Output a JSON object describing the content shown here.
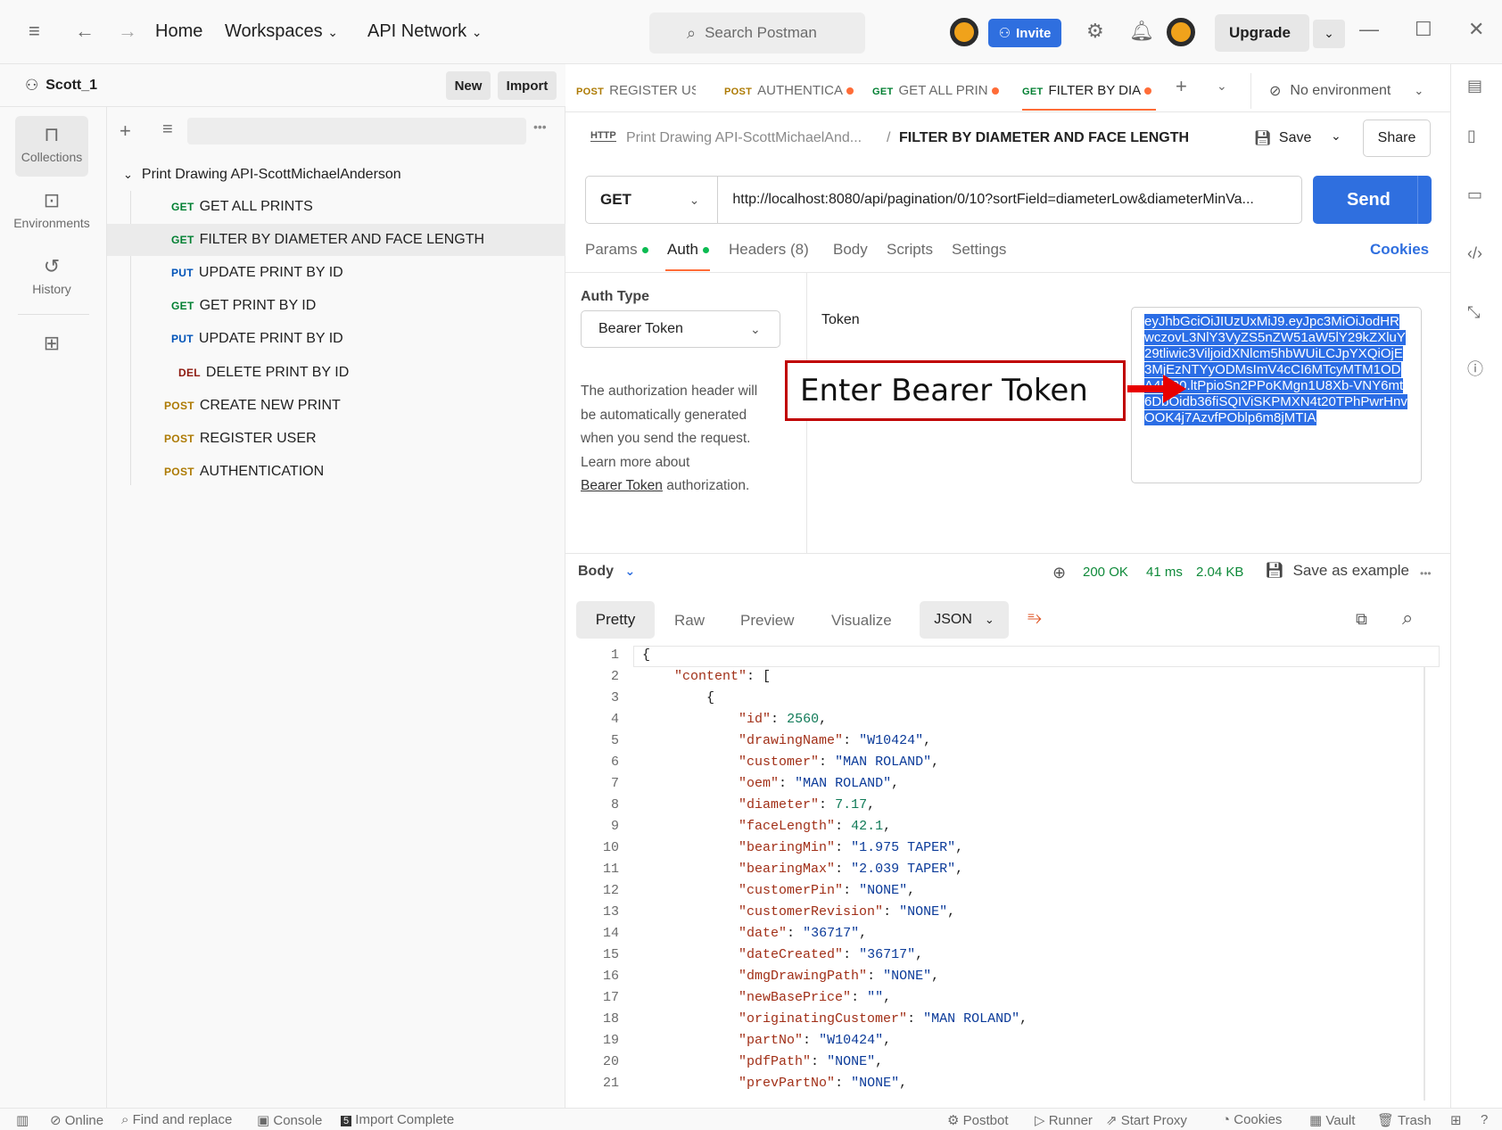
{
  "titlebar": {
    "home": "Home",
    "workspaces": "Workspaces",
    "api_network": "API Network",
    "search_placeholder": "Search Postman",
    "invite": "Invite",
    "upgrade": "Upgrade"
  },
  "leftnav": {
    "workspace_name": "Scott_1",
    "new": "New",
    "import": "Import",
    "items": [
      {
        "label": "Collections",
        "icon": "collections-icon"
      },
      {
        "label": "Environments",
        "icon": "environments-icon"
      },
      {
        "label": "History",
        "icon": "history-icon"
      }
    ]
  },
  "sidebar": {
    "collection_name": "Print Drawing API-ScottMichaelAnderson",
    "requests": [
      {
        "method": "GET",
        "name": "GET ALL PRINTS"
      },
      {
        "method": "GET",
        "name": "FILTER BY DIAMETER AND FACE LENGTH"
      },
      {
        "method": "PUT",
        "name": "UPDATE PRINT BY ID"
      },
      {
        "method": "GET",
        "name": "GET PRINT BY ID"
      },
      {
        "method": "PUT",
        "name": "UPDATE PRINT BY ID"
      },
      {
        "method": "DEL",
        "name": "DELETE PRINT BY ID"
      },
      {
        "method": "POST",
        "name": "CREATE NEW PRINT"
      },
      {
        "method": "POST",
        "name": "REGISTER USER"
      },
      {
        "method": "POST",
        "name": "AUTHENTICATION"
      }
    ]
  },
  "tabs": [
    {
      "method": "POST",
      "label": "REGISTER USI"
    },
    {
      "method": "POST",
      "label": "AUTHENTICA"
    },
    {
      "method": "GET",
      "label": "GET ALL PRIN"
    },
    {
      "method": "GET",
      "label": "FILTER BY DIA"
    }
  ],
  "environment": "No environment",
  "request": {
    "breadcrumb_collection": "Print Drawing API-ScottMichaelAnd...",
    "breadcrumb_separator": "/",
    "title": "FILTER BY DIAMETER AND FACE LENGTH",
    "save": "Save",
    "share": "Share",
    "method": "GET",
    "url": "http://localhost:8080/api/pagination/0/10?sortField=diameterLow&diameterMinVa...",
    "send": "Send",
    "subtabs": [
      "Params",
      "Auth",
      "Headers (8)",
      "Body",
      "Scripts",
      "Settings"
    ],
    "cookies": "Cookies"
  },
  "auth": {
    "type_label": "Auth Type",
    "type_value": "Bearer Token",
    "desc_1": "The authorization header will",
    "desc_2": "be automatically generated",
    "desc_3": "when you send the request.",
    "desc_4": "Learn more about",
    "link": "Bearer Token",
    "link_suffix": " authorization.",
    "token_label": "Token",
    "token_value": "eyJhbGciOiJIUzUxMiJ9.eyJpc3MiOiJodHRwczovL3NlY3VyZS5nZW51aW5lY29kZXluY29tliwic3ViljoidXNlcm5hbWUiLCJpYXQiOjE3MjEzNTYyODMsImV4cCI6MTcyMTM1ODA4M30.ltPpioSn2PPoKMgn1U8Xb-VNY6mt6DbOidb36fiSQIViSKPMXN4t20TPhPwrHnvOOK4j7AzvfPOblp6m8jMTIA",
    "callout": "Enter Bearer Token"
  },
  "response": {
    "body_label": "Body",
    "status": "200 OK",
    "time": "41 ms",
    "size": "2.04 KB",
    "save_example": "Save as example",
    "views": [
      "Pretty",
      "Raw",
      "Preview",
      "Visualize"
    ],
    "format": "JSON",
    "lines": [
      "{",
      "    \"content\": [",
      "        {",
      "            \"id\": 2560,",
      "            \"drawingName\": \"W10424\",",
      "            \"customer\": \"MAN ROLAND\",",
      "            \"oem\": \"MAN ROLAND\",",
      "            \"diameter\": 7.17,",
      "            \"faceLength\": 42.1,",
      "            \"bearingMin\": \"1.975 TAPER\",",
      "            \"bearingMax\": \"2.039 TAPER\",",
      "            \"customerPin\": \"NONE\",",
      "            \"customerRevision\": \"NONE\",",
      "            \"date\": \"36717\",",
      "            \"dateCreated\": \"36717\",",
      "            \"dmgDrawingPath\": \"NONE\",",
      "            \"newBasePrice\": \"\",",
      "            \"originatingCustomer\": \"MAN ROLAND\",",
      "            \"partNo\": \"W10424\",",
      "            \"pdfPath\": \"NONE\",",
      "            \"prevPartNo\": \"NONE\","
    ]
  },
  "statusbar": {
    "online": "Online",
    "find_replace": "Find and replace",
    "console": "Console",
    "import_complete": "Import Complete",
    "postbot": "Postbot",
    "runner": "Runner",
    "start_proxy": "Start Proxy",
    "cookies": "Cookies",
    "vault": "Vault",
    "trash": "Trash"
  }
}
